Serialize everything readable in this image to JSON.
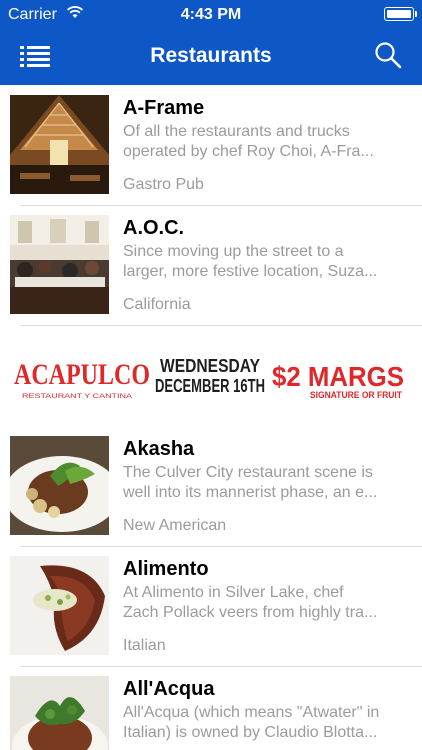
{
  "status_bar": {
    "carrier": "Carrier",
    "time": "4:43 PM"
  },
  "nav": {
    "title": "Restaurants"
  },
  "restaurants": [
    {
      "name": "A-Frame",
      "desc_line1": "Of all the restaurants and trucks",
      "desc_line2": "operated by chef Roy Choi, A-Fra...",
      "category": "Gastro Pub"
    },
    {
      "name": "A.O.C.",
      "desc_line1": "Since moving up the street to a",
      "desc_line2": "larger, more festive location, Suza...",
      "category": "California"
    },
    {
      "name": "Akasha",
      "desc_line1": "The Culver City restaurant scene is",
      "desc_line2": "well into its mannerist phase, an e...",
      "category": "New American"
    },
    {
      "name": "Alimento",
      "desc_line1": "At Alimento in Silver Lake, chef",
      "desc_line2": "Zach Pollack veers from highly tra...",
      "category": "Italian"
    },
    {
      "name": "All'Acqua",
      "desc_line1": "All'Acqua (which means \"Atwater\" in",
      "desc_line2": "Italian) is owned by Claudio Blotta...",
      "category": ""
    }
  ],
  "banner": {
    "brand": "ACAPULCO",
    "brand_sub": "RESTAURANT Y CANTINA",
    "day": "WEDNESDAY",
    "date": "DECEMBER 16TH",
    "price": "$2 MARGS",
    "price_sub": "SIGNATURE OR FRUIT"
  },
  "colors": {
    "nav_bg": "#0d57c7",
    "banner_red": "#e0282a",
    "banner_dark": "#1f1f1f",
    "muted_text": "#9b9b9b"
  }
}
